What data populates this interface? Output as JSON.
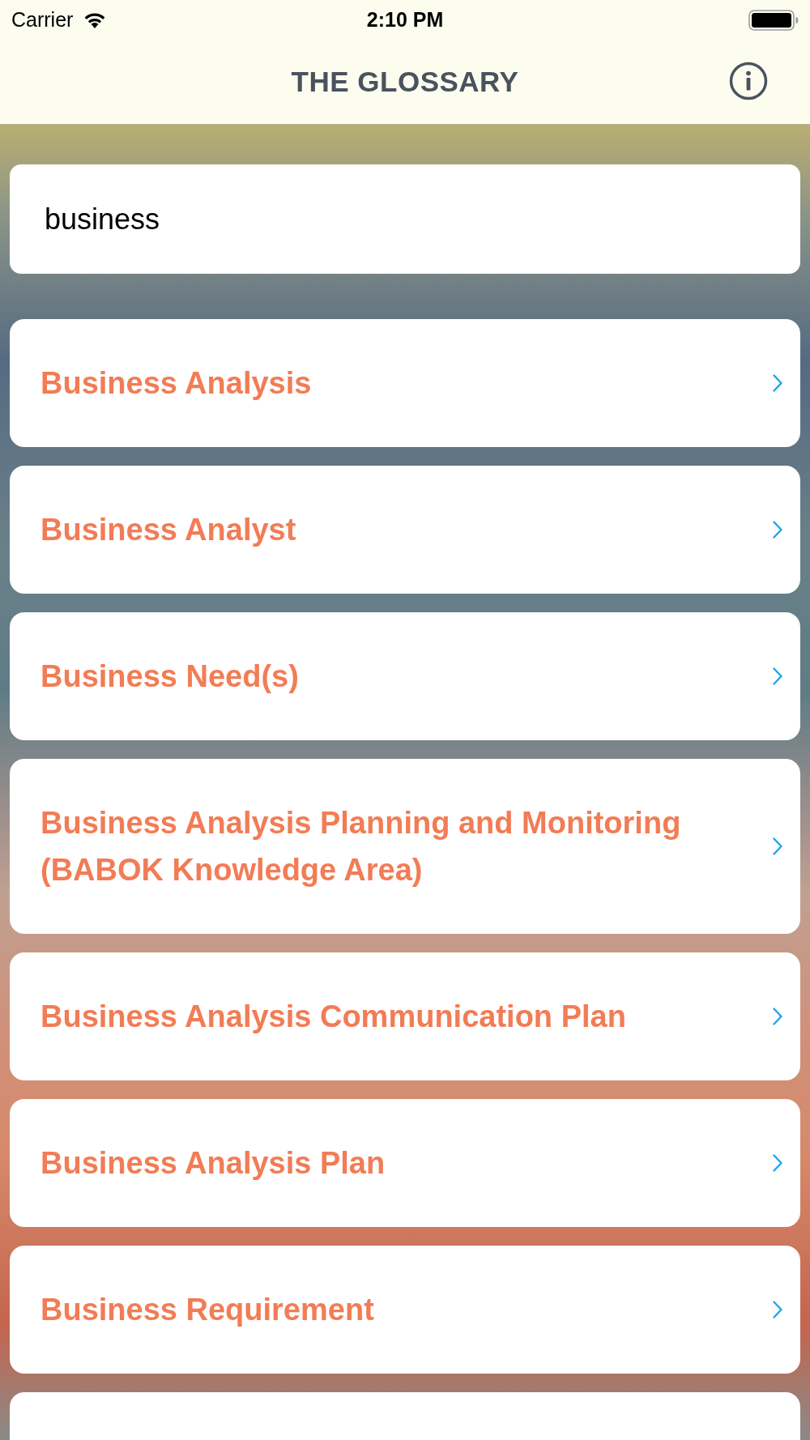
{
  "status_bar": {
    "carrier": "Carrier",
    "time": "2:10 PM"
  },
  "header": {
    "title": "THE GLOSSARY"
  },
  "search": {
    "value": "business"
  },
  "results": [
    {
      "term": "Business Analysis"
    },
    {
      "term": "Business Analyst"
    },
    {
      "term": "Business Need(s)"
    },
    {
      "term": "Business Analysis Planning and Monitoring (BABOK Knowledge Area)"
    },
    {
      "term": "Business Analysis Communication Plan"
    },
    {
      "term": "Business Analysis Plan"
    },
    {
      "term": "Business Requirement"
    }
  ]
}
